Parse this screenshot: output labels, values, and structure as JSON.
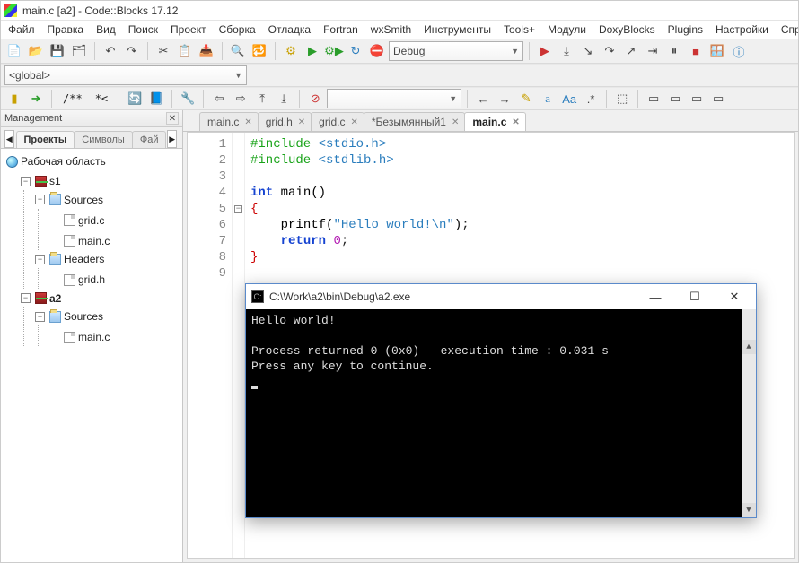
{
  "window": {
    "title": "main.c [a2] - Code::Blocks 17.12"
  },
  "menu": [
    "Файл",
    "Правка",
    "Вид",
    "Поиск",
    "Проект",
    "Сборка",
    "Отладка",
    "Fortran",
    "wxSmith",
    "Инструменты",
    "Tools+",
    "Модули",
    "DoxyBlocks",
    "Plugins",
    "Настройки",
    "Спра"
  ],
  "toolbar1": {
    "icons": [
      "new-file-icon",
      "open-icon",
      "save-icon",
      "save-all-icon",
      "undo-icon",
      "redo-icon",
      "cut-icon",
      "copy-icon",
      "paste-icon",
      "find-icon",
      "replace-icon",
      "build-icon",
      "run-icon",
      "build-run-icon",
      "rebuild-icon",
      "stop-icon"
    ],
    "build_config": "Debug",
    "debug_icons": [
      "debug-continue-icon",
      "run-to-cursor-icon",
      "step-into-icon",
      "step-over-icon",
      "step-out-icon",
      "stop-debug-icon",
      "debug-windows-icon",
      "info-icon"
    ]
  },
  "toolbar2": {
    "scope": "<global>"
  },
  "toolbar3": {
    "icons_left": [
      "goto-toggle-icon",
      "bookmark-icon"
    ],
    "txt_buttons": [
      "/**",
      "*<"
    ],
    "icons_mid": [
      "doxy-refresh-icon",
      "doxy-docs-icon",
      "settings-icon",
      "nav-back-icon",
      "nav-fwd-icon",
      "nav-up-icon",
      "block-icon",
      "abort-icon"
    ],
    "dropdown": "",
    "icons_right": [
      "jump-back-icon",
      "jump-fwd-icon",
      "highlight-icon",
      "match-case-icon",
      "whole-word-icon",
      "regex-icon",
      "select-icon",
      "bracket-l-icon",
      "bracket-r-icon",
      "bracket-x-icon",
      "indent-icon"
    ]
  },
  "management": {
    "title": "Management",
    "tabs": [
      "Проекты",
      "Символы",
      "Фай"
    ],
    "tree": {
      "workspace": "Рабочая область",
      "projects": [
        {
          "name": "s1",
          "folders": [
            {
              "name": "Sources",
              "files": [
                "grid.c",
                "main.c"
              ],
              "open": true
            },
            {
              "name": "Headers",
              "files": [
                "grid.h"
              ],
              "open": true
            }
          ],
          "bold": false
        },
        {
          "name": "a2",
          "folders": [
            {
              "name": "Sources",
              "files": [
                "main.c"
              ],
              "open": true
            }
          ],
          "bold": true
        }
      ]
    }
  },
  "editor": {
    "tabs": [
      {
        "label": "main.c",
        "active": false
      },
      {
        "label": "grid.h",
        "active": false
      },
      {
        "label": "grid.c",
        "active": false
      },
      {
        "label": "*Безымянный1",
        "active": false
      },
      {
        "label": "main.c",
        "active": true
      }
    ],
    "code": {
      "lines": [
        1,
        2,
        3,
        4,
        5,
        6,
        7,
        8,
        9
      ],
      "l1_kw": "#include",
      "l1_arg": "<stdio.h>",
      "l2_kw": "#include",
      "l2_arg": "<stdlib.h>",
      "l4_kw": "int",
      "l4_fn": "main",
      "l4_par": "()",
      "l5_brc": "{",
      "l6_fn": "printf",
      "l6_par_open": "(",
      "l6_str": "\"Hello world!\\n\"",
      "l6_par_close": ")",
      "l6_semi": ";",
      "l7_kw": "return",
      "l7_num": "0",
      "l7_semi": ";",
      "l8_brc": "}"
    }
  },
  "console": {
    "title": "C:\\Work\\a2\\bin\\Debug\\a2.exe",
    "line1": "Hello world!",
    "line2": "Process returned 0 (0x0)   execution time : 0.031 s",
    "line3": "Press any key to continue."
  }
}
